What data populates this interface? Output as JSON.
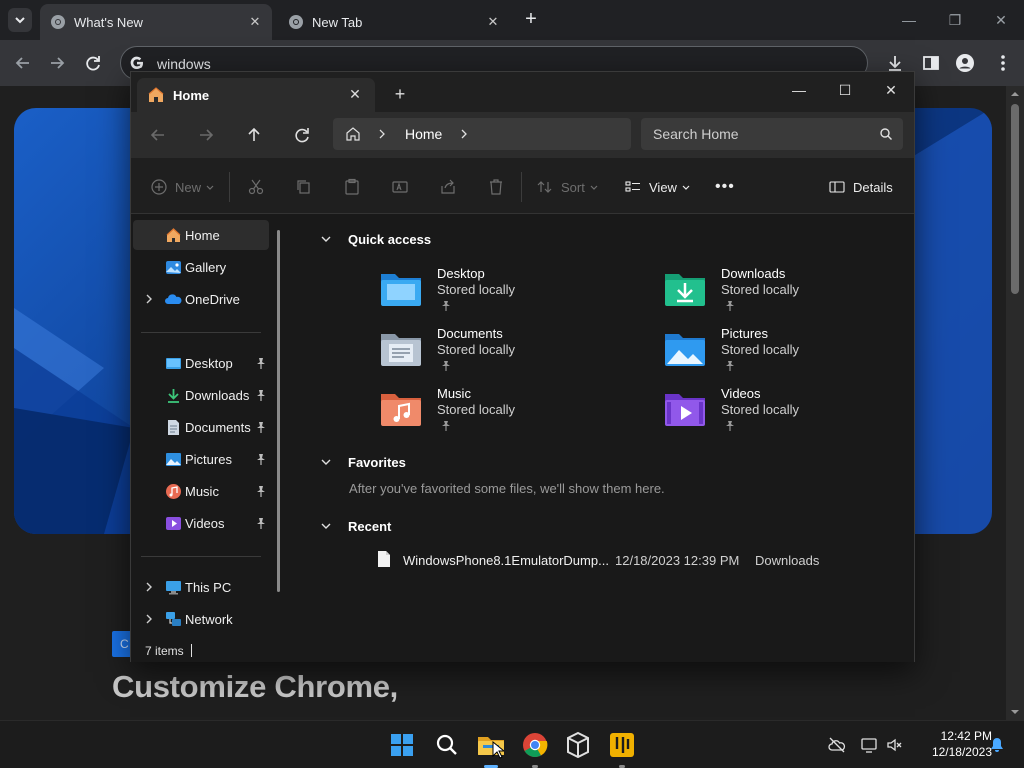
{
  "browser": {
    "tabs": [
      {
        "title": "What's New",
        "active": true
      },
      {
        "title": "New Tab",
        "active": false
      }
    ],
    "new_tab_symbol": "+",
    "omnibox": {
      "text": "windows",
      "icon": "google-g-icon"
    },
    "page": {
      "chip_text": "C",
      "heading": "Customize Chrome,"
    },
    "colors": {
      "hero_blue": "#1a5fc7",
      "toolbar": "#35363a",
      "tabstrip": "#202124"
    }
  },
  "explorer": {
    "tab_title": "Home",
    "new_tab_symbol": "+",
    "breadcrumb": {
      "current": "Home"
    },
    "search_placeholder": "Search Home",
    "commands": {
      "new": "New",
      "sort": "Sort",
      "view": "View",
      "more": "•••",
      "details": "Details"
    },
    "sidebar": {
      "top": [
        {
          "label": "Home",
          "icon": "home-icon",
          "selected": true,
          "expandable": false
        },
        {
          "label": "Gallery",
          "icon": "gallery-icon",
          "selected": false,
          "expandable": false
        },
        {
          "label": "OneDrive",
          "icon": "onedrive-icon",
          "selected": false,
          "expandable": true
        }
      ],
      "pinned": [
        {
          "label": "Desktop",
          "icon": "desktop-icon"
        },
        {
          "label": "Downloads",
          "icon": "downloads-icon"
        },
        {
          "label": "Documents",
          "icon": "documents-icon"
        },
        {
          "label": "Pictures",
          "icon": "pictures-icon"
        },
        {
          "label": "Music",
          "icon": "music-icon"
        },
        {
          "label": "Videos",
          "icon": "videos-icon"
        }
      ],
      "bottom": [
        {
          "label": "This PC",
          "icon": "this-pc-icon",
          "expandable": true
        },
        {
          "label": "Network",
          "icon": "network-icon",
          "expandable": true
        }
      ]
    },
    "quick_access": {
      "title": "Quick access",
      "items": [
        {
          "name": "Desktop",
          "subtitle": "Stored locally",
          "icon": "desktop-folder-icon"
        },
        {
          "name": "Downloads",
          "subtitle": "Stored locally",
          "icon": "downloads-folder-icon"
        },
        {
          "name": "Documents",
          "subtitle": "Stored locally",
          "icon": "documents-folder-icon"
        },
        {
          "name": "Pictures",
          "subtitle": "Stored locally",
          "icon": "pictures-folder-icon"
        },
        {
          "name": "Music",
          "subtitle": "Stored locally",
          "icon": "music-folder-icon"
        },
        {
          "name": "Videos",
          "subtitle": "Stored locally",
          "icon": "videos-folder-icon"
        }
      ]
    },
    "favorites": {
      "title": "Favorites",
      "empty_text": "After you've favorited some files, we'll show them here."
    },
    "recent": {
      "title": "Recent",
      "items": [
        {
          "name": "WindowsPhone8.1EmulatorDump...",
          "date": "12/18/2023 12:39 PM",
          "location": "Downloads"
        }
      ]
    },
    "status": {
      "items_count": "7 items"
    }
  },
  "taskbar": {
    "apps": [
      "start-icon",
      "search-icon",
      "file-explorer-icon",
      "chrome-icon",
      "virtualbox-icon",
      "app-icon"
    ],
    "clock": {
      "time": "12:42 PM",
      "date": "12/18/2023"
    }
  }
}
